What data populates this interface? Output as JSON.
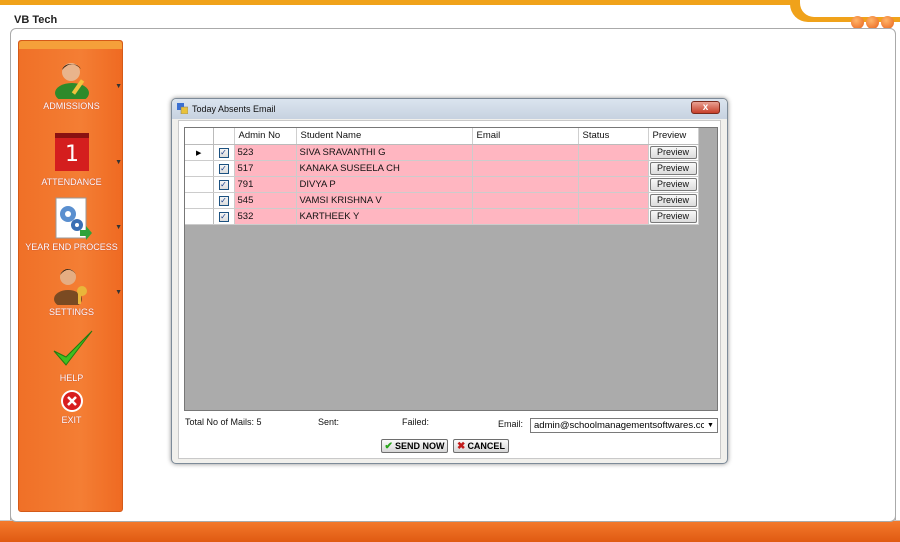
{
  "app": {
    "title": "VB Tech"
  },
  "sidebar": {
    "items": [
      {
        "label": "ADMISSIONS",
        "icon": "student-icon"
      },
      {
        "label": "ATTENDANCE",
        "icon": "calendar-icon",
        "icon_text": "1"
      },
      {
        "label": "YEAR END PROCESS",
        "icon": "gears-document-icon"
      },
      {
        "label": "SETTINGS",
        "icon": "user-key-icon"
      },
      {
        "label": "HELP",
        "icon": "checkmark-icon"
      },
      {
        "label": "EXIT",
        "icon": "exit-icon"
      }
    ]
  },
  "dialog": {
    "title": "Today Absents Email",
    "close_label": "x",
    "columns": [
      "",
      "Admin No",
      "Student Name",
      "Email",
      "Status",
      "Preview"
    ],
    "rows": [
      {
        "checked": true,
        "admin_no": "523",
        "name": "SIVA SRAVANTHI G",
        "email": "",
        "status": "",
        "preview": "Preview",
        "current": true
      },
      {
        "checked": true,
        "admin_no": "517",
        "name": "KANAKA SUSEELA CH",
        "email": "",
        "status": "",
        "preview": "Preview"
      },
      {
        "checked": true,
        "admin_no": "791",
        "name": "DIVYA  P",
        "email": "",
        "status": "",
        "preview": "Preview"
      },
      {
        "checked": true,
        "admin_no": "545",
        "name": "VAMSI KRISHNA  V",
        "email": "",
        "status": "",
        "preview": "Preview"
      },
      {
        "checked": true,
        "admin_no": "532",
        "name": "KARTHEEK Y",
        "email": "",
        "status": "",
        "preview": "Preview"
      }
    ],
    "footer": {
      "total_label": "Total No of Mails: 5",
      "sent_label": "Sent:",
      "failed_label": "Failed:",
      "email_label": "Email:",
      "email_value": "admin@schoolmanagementsoftwares.cc"
    },
    "send_label": "SEND NOW",
    "cancel_label": "CANCEL"
  },
  "colors": {
    "accent": "#f07027",
    "row_highlight": "#ffb6c1"
  }
}
